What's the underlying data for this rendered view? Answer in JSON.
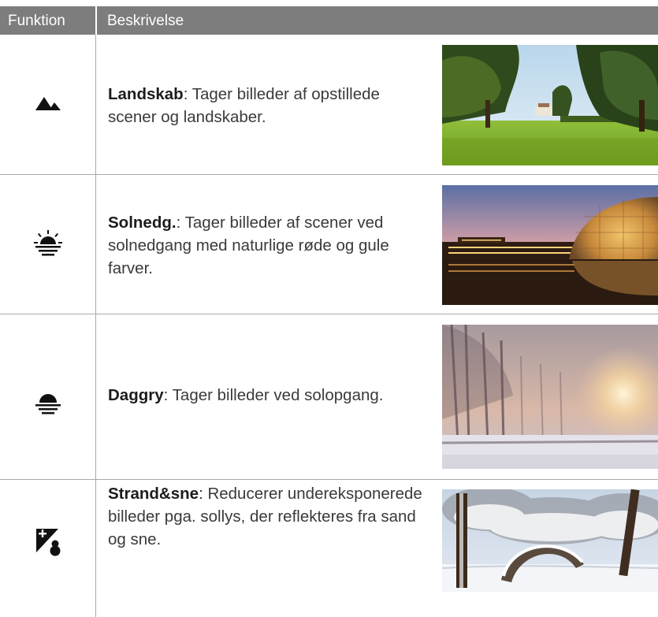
{
  "header": {
    "col_function": "Funktion",
    "col_description": "Beskrivelse"
  },
  "rows": [
    {
      "icon": "landscape-icon",
      "title": "Landskab",
      "text": ": Tager billeder af opstillede scener og landskaber.",
      "photo": "park-landscape-photo"
    },
    {
      "icon": "sunset-icon",
      "title": "Solnedg.",
      "text": ": Tager billeder af scener ved solnedgang med naturlige røde og gule farver.",
      "photo": "sunset-building-photo"
    },
    {
      "icon": "dawn-icon",
      "title": "Daggry",
      "text": ": Tager billeder ved solopgang.",
      "photo": "misty-dawn-photo"
    },
    {
      "icon": "beach-snow-icon",
      "title": "Strand&sne",
      "text": ": Reducerer undereksponerede billeder pga. sollys, der reflekteres fra sand og sne.",
      "photo": "snow-park-photo"
    }
  ],
  "colors": {
    "header_bg": "#7d7d7d",
    "rule": "#a9a9a9"
  }
}
